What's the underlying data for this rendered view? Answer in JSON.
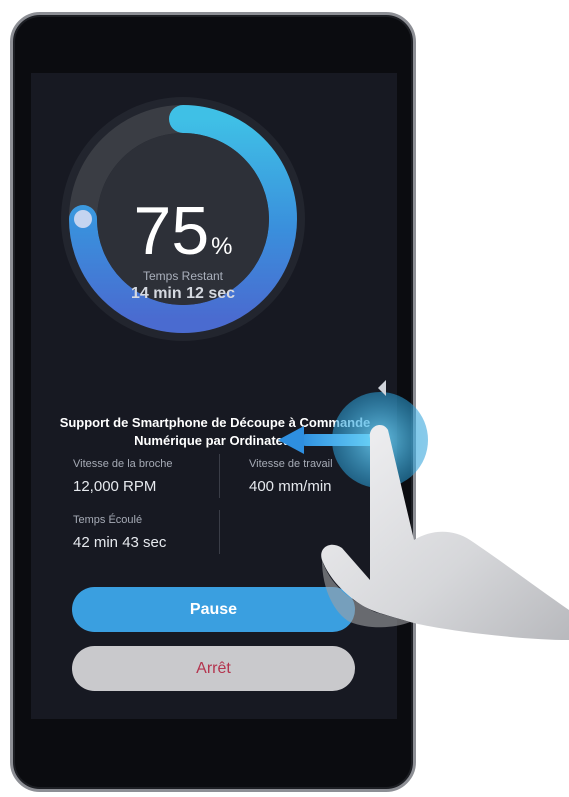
{
  "progress": {
    "percent_value": "75",
    "percent_sign": "%",
    "fraction": 0.75,
    "remaining_label": "Temps Restant",
    "remaining_value": "14 min 12 sec"
  },
  "job_title_line1": "Support de Smartphone de Découpe à Commande",
  "job_title_line2": "Numérique par Ordinateur",
  "stats": {
    "spindle_label": "Vitesse de la broche",
    "spindle_value": "12,000 RPM",
    "feed_label": "Vitesse de travail",
    "feed_value": "400 mm/min",
    "elapsed_label": "Temps Écoulé",
    "elapsed_value": "42 min 43 sec"
  },
  "buttons": {
    "pause_label": "Pause",
    "stop_label": "Arrêt"
  },
  "colors": {
    "accent_blue": "#3a9fe0",
    "stop_text": "#b4344e",
    "screen_bg": "#171922"
  },
  "icons": [
    "swipe-left-arrow-icon",
    "hand-pointer-icon"
  ]
}
